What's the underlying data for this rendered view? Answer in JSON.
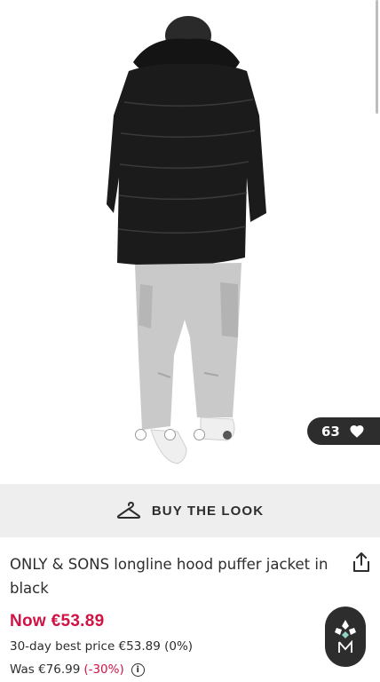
{
  "gallery": {
    "likes_count": "63",
    "dots": [
      {
        "active": false
      },
      {
        "active": false
      },
      {
        "active": false
      },
      {
        "active": true
      }
    ]
  },
  "buy_the_look": {
    "label": "BUY THE LOOK"
  },
  "product": {
    "title": "ONLY & SONS longline hood puffer jacket in black",
    "price_now": "Now €53.89",
    "best_price": "30-day best price €53.89 (0%)",
    "was_prefix": "Was €76.99",
    "was_discount": "(-30%)"
  },
  "colors": {
    "accent": "#d01345",
    "dark": "#2d2d2d",
    "band": "#eeeeee"
  },
  "icons": [
    "heart-icon",
    "hanger-icon",
    "share-icon",
    "info-icon",
    "brand-badge-icon"
  ]
}
